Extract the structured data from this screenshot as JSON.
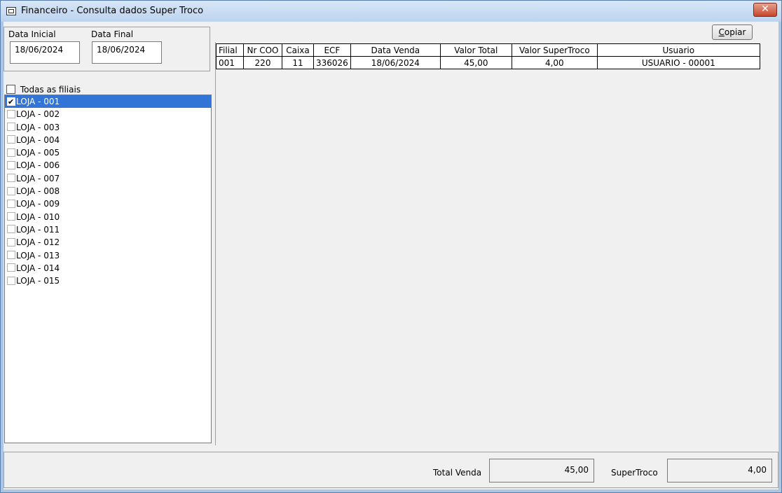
{
  "window": {
    "title": "Financeiro - Consulta dados Super Troco",
    "close_symbol": "✕"
  },
  "dates": {
    "initial_label": "Data Inicial",
    "initial_value": "18/06/2024",
    "final_label": "Data Final",
    "final_value": "18/06/2024"
  },
  "filiais": {
    "all_label": "Todas as filiais",
    "all_checked": false,
    "items": [
      {
        "label": "LOJA - 001",
        "checked": true,
        "selected": true
      },
      {
        "label": "LOJA - 002",
        "checked": false
      },
      {
        "label": "LOJA - 003",
        "checked": false
      },
      {
        "label": "LOJA - 004",
        "checked": false
      },
      {
        "label": "LOJA - 005",
        "checked": false
      },
      {
        "label": "LOJA - 006",
        "checked": false
      },
      {
        "label": "LOJA - 007",
        "checked": false
      },
      {
        "label": "LOJA - 008",
        "checked": false
      },
      {
        "label": "LOJA - 009",
        "checked": false
      },
      {
        "label": "LOJA - 010",
        "checked": false
      },
      {
        "label": "LOJA - 011",
        "checked": false
      },
      {
        "label": "LOJA - 012",
        "checked": false
      },
      {
        "label": "LOJA - 013",
        "checked": false
      },
      {
        "label": "LOJA - 014",
        "checked": false
      },
      {
        "label": "LOJA - 015",
        "checked": false
      }
    ]
  },
  "toolbar": {
    "copy_label": "Copiar",
    "copy_accel": "C",
    "copy_rest": "opiar"
  },
  "grid": {
    "columns": [
      "Filial",
      "Nr COO",
      "Caixa",
      "ECF",
      "Data Venda",
      "Valor Total",
      "Valor SuperTroco",
      "Usuario"
    ],
    "rows": [
      [
        "001",
        "220",
        "11",
        "336026",
        "18/06/2024",
        "45,00",
        "4,00",
        "USUARIO - 00001"
      ]
    ]
  },
  "footer": {
    "total_venda_label": "Total Venda",
    "total_venda_value": "45,00",
    "supertroco_label": "SuperTroco",
    "supertroco_value": "4,00"
  },
  "colors": {
    "selection": "#3375d6",
    "title_bar": "#bcd3ee",
    "close": "#c6452b"
  }
}
